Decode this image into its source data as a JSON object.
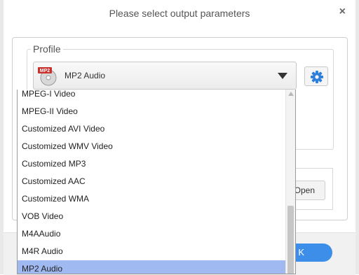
{
  "dialog": {
    "title": "Please select output parameters",
    "close_glyph": "×"
  },
  "profile": {
    "legend": "Profile",
    "selected": "MP2 Audio",
    "selected_icon": "mp2-file-icon",
    "icon_badge": "MP2",
    "settings_icon": "gear-icon"
  },
  "dropdown": {
    "items": [
      "MPEG-I Video",
      "MPEG-II Video",
      "Customized AVI Video",
      "Customized WMV Video",
      "Customized MP3",
      "Customized AAC",
      "Customized WMA",
      "VOB Video",
      "M4AAudio",
      "M4R Audio",
      "MP2 Audio"
    ],
    "selected_index": 10
  },
  "buttons": {
    "open": "Open",
    "ok": "K"
  },
  "colors": {
    "accent": "#3d8ee8",
    "selection": "#a0b9f0",
    "gear": "#2f7fdc"
  }
}
